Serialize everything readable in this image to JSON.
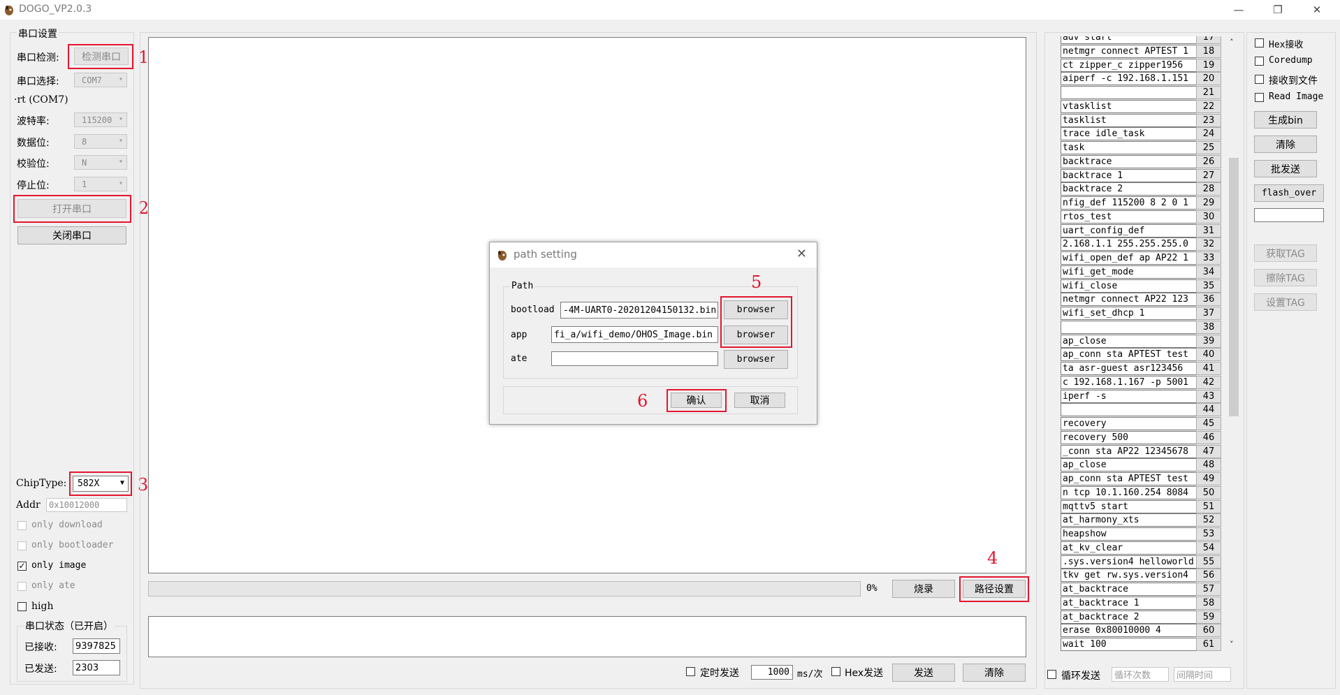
{
  "window": {
    "title": "DOGO_VP2.0.3",
    "controls": [
      "minimize-icon",
      "maximize-icon",
      "close-icon"
    ]
  },
  "left_panel": {
    "serial_group_title": "串口设置",
    "detect_label": "串口检测:",
    "detect_button": "检测串口",
    "select_label": "串口选择:",
    "port_value": "COM7",
    "port_desc": "·rt (COM7)",
    "baud_label": "波特率:",
    "baud_value": "115200",
    "databits_label": "数据位:",
    "databits_value": "8",
    "parity_label": "校验位:",
    "parity_value": "N",
    "stopbits_label": "停止位:",
    "stopbits_value": "1",
    "open_button": "打开串口",
    "close_button": "关闭串口",
    "chiptype_label": "ChipType:",
    "chiptype_value": "582X",
    "addr_label": "Addr",
    "addr_value": "0x10012000",
    "options": [
      {
        "label": "only download",
        "checked": false,
        "disabled": true
      },
      {
        "label": "only bootloader",
        "checked": false,
        "disabled": true
      },
      {
        "label": "only image",
        "checked": true,
        "disabled": false
      },
      {
        "label": "only ate",
        "checked": false,
        "disabled": true
      },
      {
        "label": "high",
        "checked": false,
        "disabled": false
      }
    ],
    "status_group_title": "串口状态（已开启）",
    "received_label": "已接收:",
    "received_value": "9397825",
    "sent_label": "已发送:",
    "sent_value": "2303"
  },
  "annotations": [
    "1",
    "2",
    "3",
    "4",
    "5",
    "6"
  ],
  "center": {
    "progress_percent": 0,
    "progress_label": "0%",
    "burn_button": "烧录",
    "path_setting_button": "路径设置",
    "timed_send_label": "定时发送",
    "interval_value": "1000",
    "interval_unit": "ms/次",
    "hex_send_label": "Hex发送",
    "send_button": "发送",
    "clear_button": "清除"
  },
  "dialog": {
    "title": "path setting",
    "group_label": "Path",
    "rows": [
      {
        "label": "bootload",
        "value": "-4M-UART0-20201204150132.bin",
        "button": "browser"
      },
      {
        "label": "app",
        "value": "fi_a/wifi_demo/OHOS_Image.bin",
        "button": "browser"
      },
      {
        "label": "ate",
        "value": "",
        "button": "browser"
      }
    ],
    "ok_button": "确认",
    "cancel_button": "取消"
  },
  "command_list": [
    {
      "cmd": "adv start",
      "num": "17"
    },
    {
      "cmd": "netmgr connect APTEST  1",
      "num": "18"
    },
    {
      "cmd": "ct zipper_c  zipper1956",
      "num": "19"
    },
    {
      "cmd": "aiperf -c 192.168.1.151",
      "num": "20"
    },
    {
      "cmd": "",
      "num": "21"
    },
    {
      "cmd": "vtasklist",
      "num": "22"
    },
    {
      "cmd": "tasklist",
      "num": "23"
    },
    {
      "cmd": "trace idle_task",
      "num": "24"
    },
    {
      "cmd": "task",
      "num": "25"
    },
    {
      "cmd": "backtrace",
      "num": "26"
    },
    {
      "cmd": "backtrace 1",
      "num": "27"
    },
    {
      "cmd": "backtrace 2",
      "num": "28"
    },
    {
      "cmd": "nfig_def 115200 8 2 0 1",
      "num": "29"
    },
    {
      "cmd": "rtos_test",
      "num": "30"
    },
    {
      "cmd": "uart_config_def",
      "num": "31"
    },
    {
      "cmd": "2.168.1.1 255.255.255.0",
      "num": "32"
    },
    {
      "cmd": "wifi_open_def ap AP22 1",
      "num": "33"
    },
    {
      "cmd": "wifi_get_mode",
      "num": "34"
    },
    {
      "cmd": "wifi_close",
      "num": "35"
    },
    {
      "cmd": "netmgr connect AP22 123",
      "num": "36"
    },
    {
      "cmd": "wifi_set_dhcp 1",
      "num": "37"
    },
    {
      "cmd": "",
      "num": "38"
    },
    {
      "cmd": "ap_close",
      "num": "39"
    },
    {
      "cmd": "ap_conn sta APTEST test",
      "num": "40"
    },
    {
      "cmd": "ta asr-guest  asr123456",
      "num": "41"
    },
    {
      "cmd": "c 192.168.1.167 -p 5001",
      "num": "42"
    },
    {
      "cmd": "iperf -s",
      "num": "43"
    },
    {
      "cmd": "",
      "num": "44"
    },
    {
      "cmd": "recovery",
      "num": "45"
    },
    {
      "cmd": "recovery 500",
      "num": "46"
    },
    {
      "cmd": "_conn sta AP22 12345678",
      "num": "47"
    },
    {
      "cmd": "ap_close",
      "num": "48"
    },
    {
      "cmd": "ap_conn sta APTEST test",
      "num": "49"
    },
    {
      "cmd": "n tcp 10.1.160.254 8084",
      "num": "50"
    },
    {
      "cmd": "mqttv5 start",
      "num": "51"
    },
    {
      "cmd": "at_harmony_xts",
      "num": "52"
    },
    {
      "cmd": "heapshow",
      "num": "53"
    },
    {
      "cmd": "at_kv_clear",
      "num": "54"
    },
    {
      "cmd": ".sys.version4 helloworld",
      "num": "55"
    },
    {
      "cmd": "tkv get rw.sys.version4",
      "num": "56"
    },
    {
      "cmd": "at_backtrace",
      "num": "57"
    },
    {
      "cmd": "at_backtrace 1",
      "num": "58"
    },
    {
      "cmd": "at_backtrace 2",
      "num": "59"
    },
    {
      "cmd": "erase 0x80010000 4",
      "num": "60"
    },
    {
      "cmd": "wait 100",
      "num": "61"
    }
  ],
  "command_footer": {
    "loop_send_label": "循环发送",
    "loop_count_placeholder": "循环次数",
    "interval_placeholder": "间隔时间"
  },
  "right_panel": {
    "checkboxes": [
      "Hex接收",
      "Coredump",
      "接收到文件",
      "Read Image"
    ],
    "gen_bin_button": "生成bin",
    "clear_button": "清除",
    "batch_send_button": "批发送",
    "flash_over_button": "flash_over",
    "get_tag_button": "获取TAG",
    "erase_tag_button": "擦除TAG",
    "set_tag_button": "设置TAG"
  }
}
